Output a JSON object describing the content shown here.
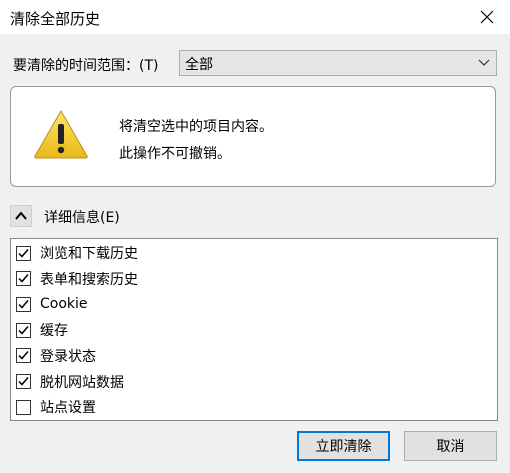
{
  "window": {
    "title": "清除全部历史",
    "close_icon": "close-icon"
  },
  "time_range": {
    "label": "要清除的时间范围：(T)",
    "selected": "全部"
  },
  "warning": {
    "icon": "warning-icon",
    "line1": "将清空选中的项目内容。",
    "line2": "此操作不可撤销。"
  },
  "details": {
    "label": "详细信息(E)",
    "expanded": true
  },
  "items": [
    {
      "label": "浏览和下载历史",
      "checked": true
    },
    {
      "label": "表单和搜索历史",
      "checked": true
    },
    {
      "label": "Cookie",
      "checked": true
    },
    {
      "label": "缓存",
      "checked": true
    },
    {
      "label": "登录状态",
      "checked": true
    },
    {
      "label": "脱机网站数据",
      "checked": true
    },
    {
      "label": "站点设置",
      "checked": false
    }
  ],
  "buttons": {
    "clear": "立即清除",
    "cancel": "取消"
  },
  "colors": {
    "accent": "#0078d7",
    "warning_yellow": "#f5c518"
  }
}
